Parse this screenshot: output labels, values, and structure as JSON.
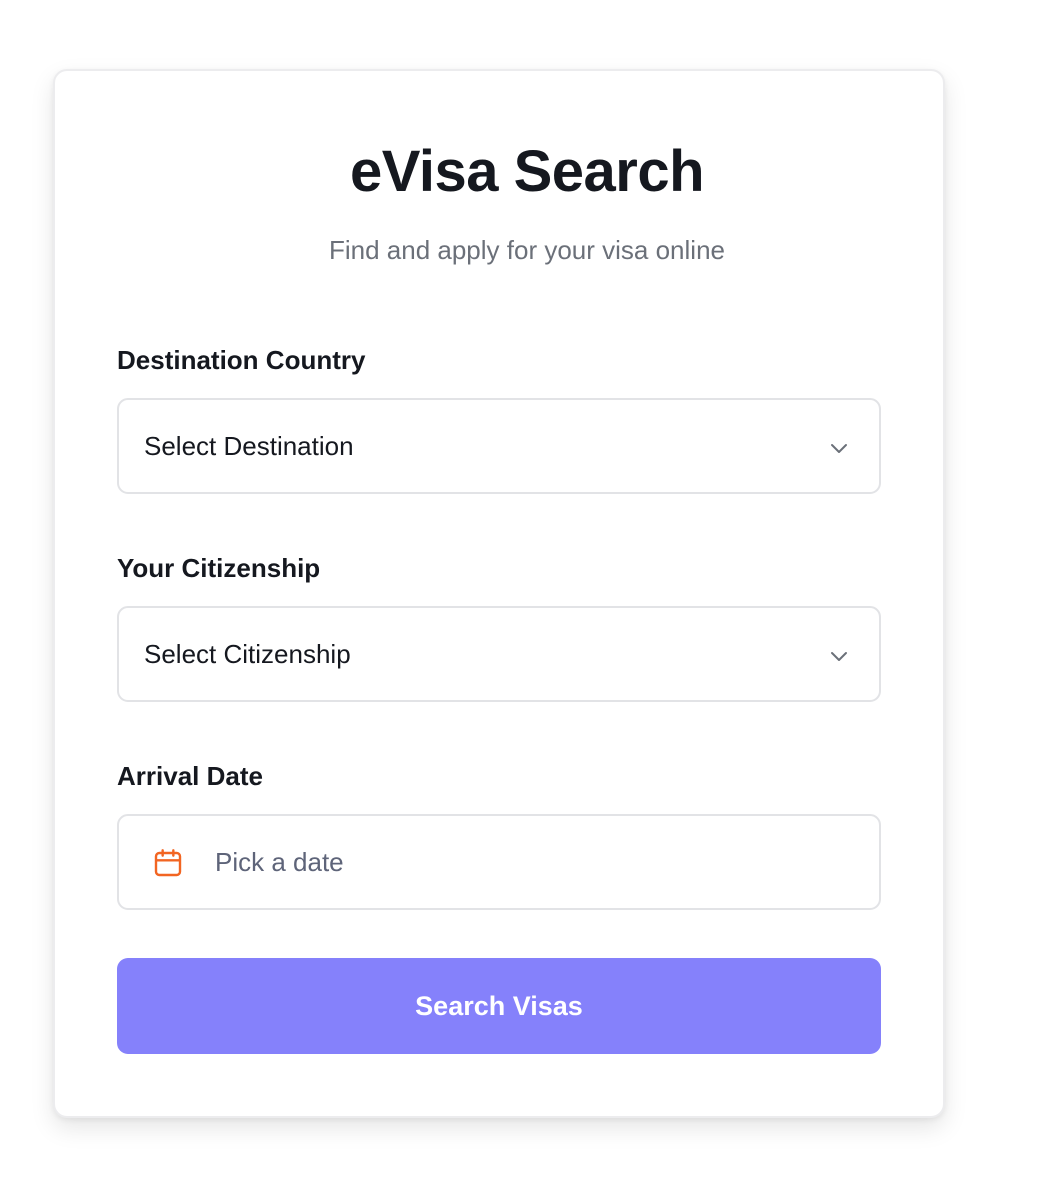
{
  "form": {
    "title": "eVisa Search",
    "subtitle": "Find and apply for your visa online",
    "destination": {
      "label": "Destination Country",
      "selected": "Select Destination"
    },
    "citizenship": {
      "label": "Your Citizenship",
      "selected": "Select Citizenship"
    },
    "arrival_date": {
      "label": "Arrival Date",
      "placeholder": "Pick a date"
    },
    "submit_label": "Search Visas"
  },
  "icons": {
    "select_chevron": "chevron-down-icon",
    "date": "calendar-icon"
  },
  "colors": {
    "primary_button": "#8581fb",
    "calendar_icon": "#f26522",
    "heading_text": "#15181f",
    "muted_text": "#6b7079",
    "border": "#e2e3e6"
  }
}
